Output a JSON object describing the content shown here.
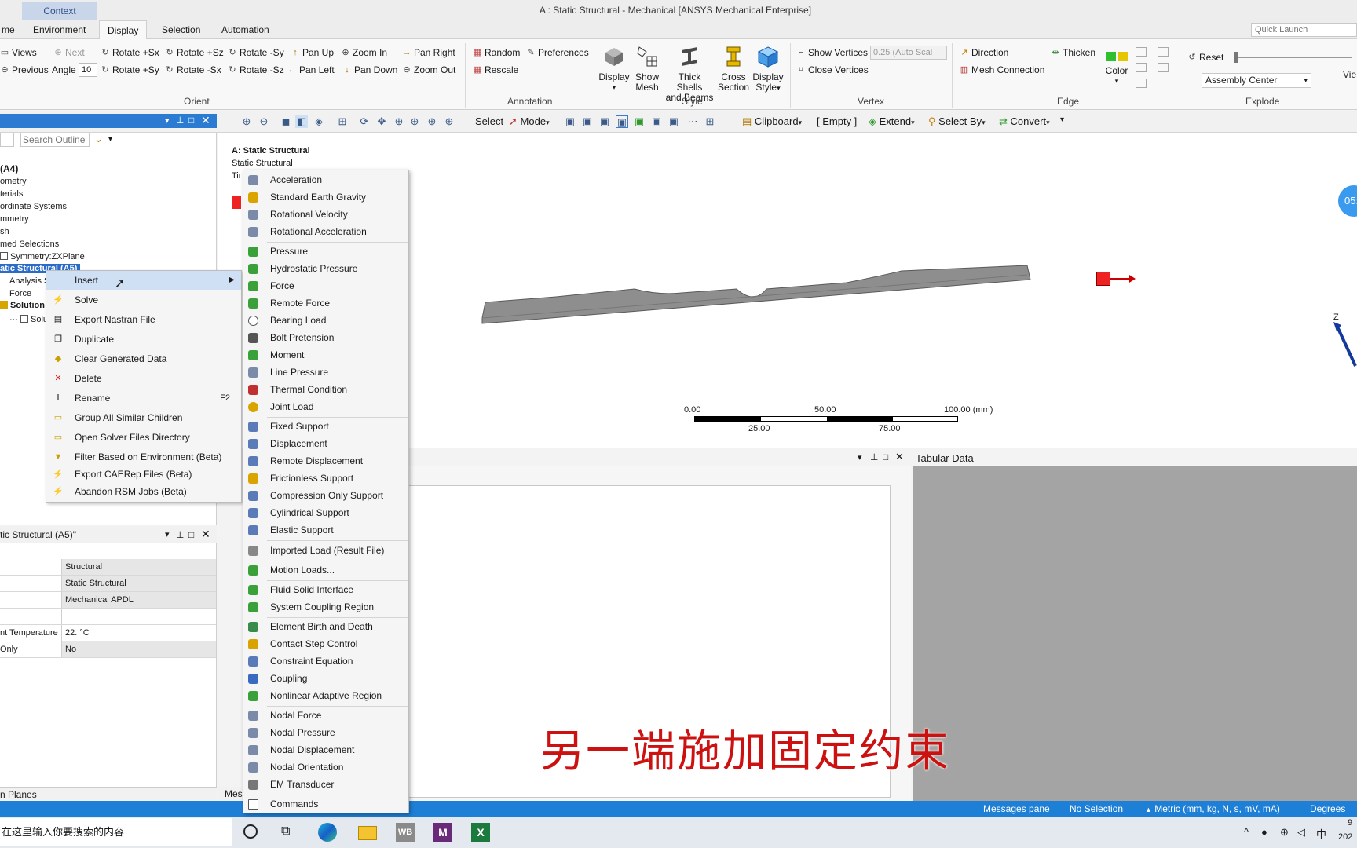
{
  "titlebar": {
    "context_tab": "Context",
    "title": "A : Static Structural - Mechanical [ANSYS Mechanical Enterprise]"
  },
  "tabs": [
    "me",
    "Environment",
    "Display",
    "Selection",
    "Automation"
  ],
  "quick_launch_placeholder": "Quick Launch",
  "ribbon": {
    "orient": {
      "row1": [
        "Views",
        "Next",
        "Rotate +Sx",
        "Rotate +Sz",
        "Rotate -Sy",
        "Pan Up",
        "Zoom In",
        "Pan Right"
      ],
      "row2": [
        "Previous",
        "Angle",
        "Rotate +Sy",
        "Rotate -Sx",
        "Rotate -Sz",
        "Pan Left",
        "Pan Down",
        "Zoom Out"
      ],
      "angle_value": "10",
      "label": "Orient"
    },
    "annotation": {
      "random": "Random",
      "preferences": "Preferences",
      "rescale": "Rescale",
      "label": "Annotation"
    },
    "style": {
      "display": "Display",
      "show_mesh": [
        "Show",
        "Mesh"
      ],
      "thick_shells": [
        "Thick Shells",
        "and Beams"
      ],
      "cross_section": [
        "Cross",
        "Section"
      ],
      "display_style": [
        "Display",
        "Style"
      ],
      "label": "Style"
    },
    "vertex": {
      "show_vertices": "Show Vertices",
      "scale_value": "0.25 (Auto Scal",
      "close_vertices": "Close Vertices",
      "label": "Vertex"
    },
    "edge": {
      "direction": "Direction",
      "thicken": "Thicken",
      "mesh_connection": "Mesh Connection",
      "color": "Color",
      "label": "Edge"
    },
    "explode": {
      "reset": "Reset",
      "assembly_center": "Assembly Center",
      "label": "Explode"
    },
    "view_cut": "Vie"
  },
  "toolbar2": {
    "select": "Select",
    "mode": "Mode",
    "clipboard": "Clipboard",
    "empty": "[ Empty ]",
    "extend": "Extend",
    "select_by": "Select By",
    "convert": "Convert"
  },
  "outline": {
    "search_placeholder": "Search Outline",
    "items": [
      "(A4)",
      "ometry",
      "terials",
      "ordinate Systems",
      "mmetry",
      "sh",
      "med Selections",
      "Symmetry:ZXPlane",
      "atic Structural (A5)",
      "Analysis S",
      "Force",
      "Solution",
      "Solu"
    ]
  },
  "context_menu": [
    {
      "label": "Insert",
      "shortcut": ""
    },
    {
      "label": "Solve",
      "shortcut": ""
    },
    {
      "label": "Export Nastran File",
      "shortcut": ""
    },
    {
      "label": "Duplicate",
      "shortcut": ""
    },
    {
      "label": "Clear Generated Data",
      "shortcut": ""
    },
    {
      "label": "Delete",
      "shortcut": ""
    },
    {
      "label": "Rename",
      "shortcut": "F2"
    },
    {
      "label": "Group All Similar Children",
      "shortcut": ""
    },
    {
      "label": "Open Solver Files Directory",
      "shortcut": ""
    },
    {
      "label": "Filter Based on Environment (Beta)",
      "shortcut": ""
    },
    {
      "label": "Export CAERep Files (Beta)",
      "shortcut": ""
    },
    {
      "label": "Abandon RSM Jobs (Beta)",
      "shortcut": ""
    }
  ],
  "insert_submenu": {
    "groups": [
      [
        "Acceleration",
        "Standard Earth Gravity",
        "Rotational Velocity",
        "Rotational Acceleration"
      ],
      [
        "Pressure",
        "Hydrostatic Pressure",
        "Force",
        "Remote Force",
        "Bearing Load",
        "Bolt Pretension",
        "Moment",
        "Line Pressure",
        "Thermal Condition",
        "Joint Load"
      ],
      [
        "Fixed Support",
        "Displacement",
        "Remote Displacement",
        "Frictionless Support",
        "Compression Only Support",
        "Cylindrical Support",
        "Elastic Support"
      ],
      [
        "Imported Load (Result File)"
      ],
      [
        "Motion Loads..."
      ],
      [
        "Fluid Solid Interface",
        "System Coupling Region"
      ],
      [
        "Element Birth and Death",
        "Contact Step Control",
        "Constraint Equation",
        "Coupling",
        "Nonlinear Adaptive Region"
      ],
      [
        "Nodal Force",
        "Nodal Pressure",
        "Nodal Displacement",
        "Nodal Orientation",
        "EM Transducer"
      ],
      [
        "Commands"
      ]
    ]
  },
  "details": {
    "header": "tic Structural (A5)\"",
    "rows": [
      {
        "k": "",
        "v": "Structural"
      },
      {
        "k": "",
        "v": "Static Structural"
      },
      {
        "k": "",
        "v": "Mechanical APDL"
      },
      {
        "k": "",
        "v": ""
      },
      {
        "k": "nt Temperature",
        "v": "22. °C"
      },
      {
        "k": "Only",
        "v": "No"
      }
    ]
  },
  "graphics": {
    "title": "A: Static Structural",
    "subtitle": "Static Structural",
    "time_label": "Tir",
    "scale_top": [
      "0.00",
      "50.00",
      "100.00 (mm)"
    ],
    "scale_bottom": [
      "25.00",
      "75.00"
    ],
    "axis_label": "Z",
    "clock": "05:"
  },
  "panes": {
    "tabular_data": "Tabular Data",
    "bottom_left": "n Planes",
    "bottom_mes": "Mes"
  },
  "statusbar": {
    "messages": "Messages pane",
    "selection": "No Selection",
    "units": "Metric (mm, kg, N, s, mV, mA)",
    "angle": "Degrees"
  },
  "taskbar": {
    "search": "在这里输入你要搜索的内容",
    "ime": "中",
    "year": "202",
    "clock_top": "9"
  },
  "subtitle_caption": "另一端施加固定约束",
  "colors": {
    "accent": "#1e7fd6",
    "highlight": "#cfe0f5",
    "subtitle": "#cc1111",
    "part": "#8c8c8c",
    "tabular_bg": "#a4a4a4"
  }
}
